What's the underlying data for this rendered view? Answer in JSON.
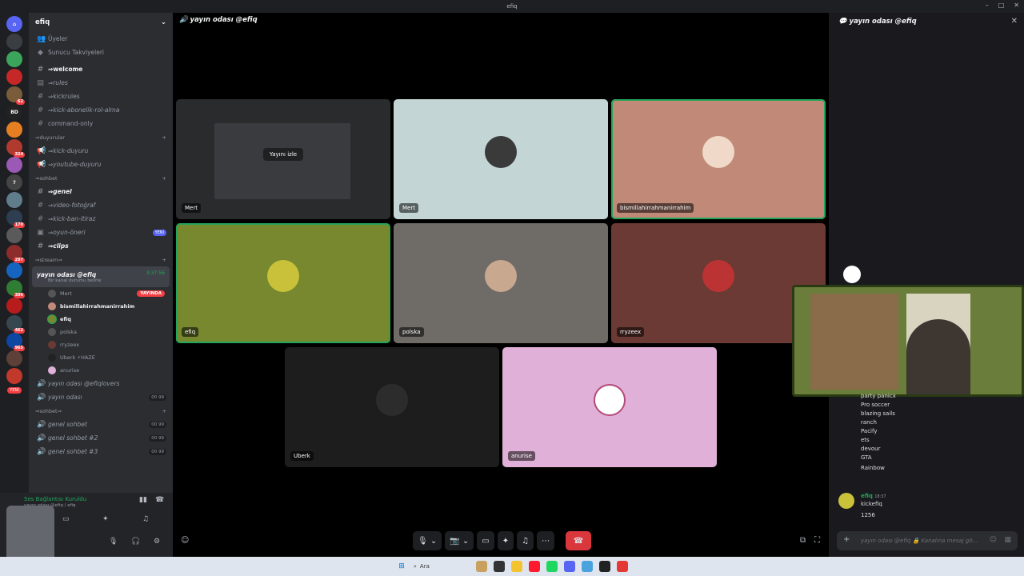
{
  "window": {
    "title": "efiq"
  },
  "server": {
    "name": "efiq"
  },
  "sidebar": {
    "top_items": [
      {
        "label": "Üyeler"
      },
      {
        "label": "Sunucu Takviyeleri"
      }
    ],
    "channels": [
      {
        "label": "⇒welcome"
      },
      {
        "label": "⇒rules"
      },
      {
        "label": "⇒kickrules"
      },
      {
        "label": "⇒kick-abonelik-rol-alma"
      },
      {
        "label": "command-only"
      }
    ],
    "cat_duyurular": "⇒duyurular",
    "duyurular": [
      {
        "label": "⇒kick-duyuru"
      },
      {
        "label": "⇒youtube-duyuru"
      }
    ],
    "cat_sohbet": "⇒sohbet",
    "sohbet": [
      {
        "label": "⇒genel"
      },
      {
        "label": "⇒video-fotoğraf"
      },
      {
        "label": "⇒kick-ban-itiraz"
      },
      {
        "label": "⇒oyun-öneri",
        "badge": "YENİ"
      },
      {
        "label": "⇒clips"
      }
    ],
    "cat_stream": "⇒stream⇒",
    "active_voice": {
      "label": "yayın odası @efiq",
      "status": "Bir kanal durumu belirle",
      "time": "3:37:56"
    },
    "voice_users": [
      {
        "name": "Mert",
        "live": "YAYINDA"
      },
      {
        "name": "bismillahirrahmanirrahim"
      },
      {
        "name": "efiq"
      },
      {
        "name": "polska"
      },
      {
        "name": "rryzeex"
      },
      {
        "name": "Uberk ⚡HAZE"
      },
      {
        "name": "anurise"
      }
    ],
    "other_voice": [
      {
        "label": "yayın odası @efiqlovers",
        "count": ""
      },
      {
        "label": "yayın odası",
        "count": "00 99"
      }
    ],
    "cat_voice": "⇒sohbet⇒",
    "voice_rooms": [
      {
        "label": "genel sohbet",
        "count": "00 99"
      },
      {
        "label": "genel sohbet #2",
        "count": "00 99"
      },
      {
        "label": "genel sohbet #3",
        "count": "00 99"
      }
    ]
  },
  "user_bar": {
    "status": "Ses Bağlantısı Kuruldu",
    "sub": "yayın odası @efiq / efiq"
  },
  "rail_badges": [
    "62",
    "324",
    "170",
    "297",
    "396",
    "462",
    "965",
    "YENİ"
  ],
  "stage": {
    "header": "yayın odası @efiq",
    "watch_label": "Yayını izle",
    "tiles": [
      {
        "name": "Mert",
        "bg": "#2a2b2d",
        "stream": true
      },
      {
        "name": "Mert",
        "bg": "#c3d6d5"
      },
      {
        "name": "bismillahirrahmanirrahim",
        "bg": "#c18a78"
      },
      {
        "name": "efiq",
        "bg": "#77882f"
      },
      {
        "name": "polska",
        "bg": "#6f6c68"
      },
      {
        "name": "rryzeex",
        "bg": "#6b3a34"
      },
      {
        "name": "Uberk",
        "bg": "#1d1d1d"
      },
      {
        "name": "anurise",
        "bg": "#e0b0d8"
      }
    ]
  },
  "chat": {
    "header": "yayın odası @efiq",
    "list": [
      "party panicx",
      "Pro soccer",
      "blazing sails",
      "ranch",
      "Pacify",
      "ets",
      "devour",
      "GTA",
      "Rainbow"
    ],
    "msg_author": "efiq",
    "msg_time": "18:37",
    "msg_lines": [
      "kickefiq",
      "1256"
    ],
    "input_placeholder": "yayın odası @efiq 🔒 Kanalına mesaj gö..."
  },
  "taskbar": {
    "search": "Ara"
  }
}
